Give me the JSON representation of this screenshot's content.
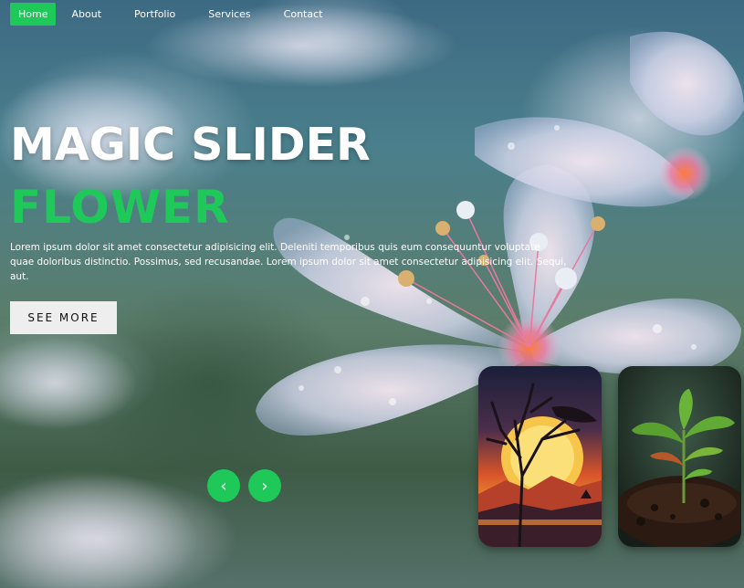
{
  "nav": {
    "items": [
      {
        "label": "Home",
        "active": true
      },
      {
        "label": "About",
        "active": false
      },
      {
        "label": "Portfolio",
        "active": false
      },
      {
        "label": "Services",
        "active": false
      },
      {
        "label": "Contact",
        "active": false
      }
    ]
  },
  "hero": {
    "title": "MAGIC SLIDER",
    "subtitle": "FLOWER",
    "description": "Lorem ipsum dolor sit amet consectetur adipisicing elit. Deleniti temporibus quis eum consequuntur voluptate quae doloribus distinctio. Possimus, sed recusandae. Lorem ipsum dolor sit amet consectetur adipisicing elit. Sequi, aut.",
    "cta_label": "SEE MORE"
  },
  "slider": {
    "prev_icon": "‹",
    "next_icon": "›"
  },
  "colors": {
    "accent": "#1ec95a",
    "text": "#ffffff",
    "button_bg": "#eeeeee"
  }
}
